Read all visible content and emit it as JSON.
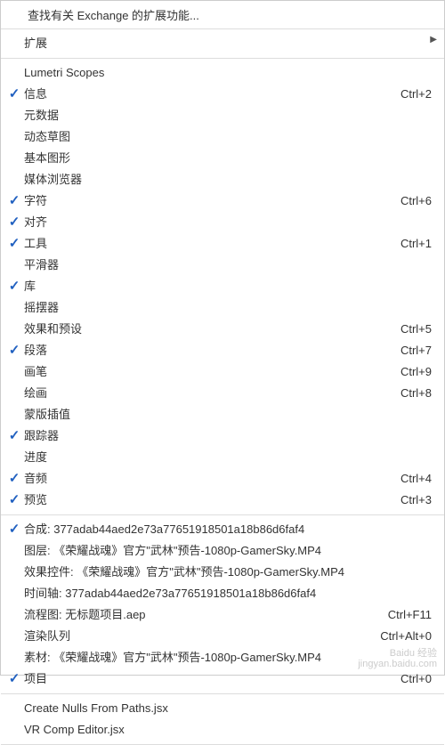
{
  "top": {
    "label": "查找有关 Exchange 的扩展功能..."
  },
  "extensions_header": {
    "label": "扩展"
  },
  "submenu_arrow": "▶",
  "panels": [
    {
      "checked": false,
      "label": "Lumetri Scopes",
      "shortcut": "",
      "name": "lumetri-scopes"
    },
    {
      "checked": true,
      "label": "信息",
      "shortcut": "Ctrl+2",
      "name": "info"
    },
    {
      "checked": false,
      "label": "元数据",
      "shortcut": "",
      "name": "metadata"
    },
    {
      "checked": false,
      "label": "动态草图",
      "shortcut": "",
      "name": "motion-sketch"
    },
    {
      "checked": false,
      "label": "基本图形",
      "shortcut": "",
      "name": "essential-graphics"
    },
    {
      "checked": false,
      "label": "媒体浏览器",
      "shortcut": "",
      "name": "media-browser"
    },
    {
      "checked": true,
      "label": "字符",
      "shortcut": "Ctrl+6",
      "name": "character"
    },
    {
      "checked": true,
      "label": "对齐",
      "shortcut": "",
      "name": "align"
    },
    {
      "checked": true,
      "label": "工具",
      "shortcut": "Ctrl+1",
      "name": "tools"
    },
    {
      "checked": false,
      "label": "平滑器",
      "shortcut": "",
      "name": "smoother"
    },
    {
      "checked": true,
      "label": "库",
      "shortcut": "",
      "name": "libraries"
    },
    {
      "checked": false,
      "label": "摇摆器",
      "shortcut": "",
      "name": "wiggler"
    },
    {
      "checked": false,
      "label": "效果和预设",
      "shortcut": "Ctrl+5",
      "name": "effects-presets"
    },
    {
      "checked": true,
      "label": "段落",
      "shortcut": "Ctrl+7",
      "name": "paragraph"
    },
    {
      "checked": false,
      "label": "画笔",
      "shortcut": "Ctrl+9",
      "name": "brushes"
    },
    {
      "checked": false,
      "label": "绘画",
      "shortcut": "Ctrl+8",
      "name": "paint"
    },
    {
      "checked": false,
      "label": "蒙版插值",
      "shortcut": "",
      "name": "mask-interpolation"
    },
    {
      "checked": true,
      "label": "跟踪器",
      "shortcut": "",
      "name": "tracker"
    },
    {
      "checked": false,
      "label": "进度",
      "shortcut": "",
      "name": "progress"
    },
    {
      "checked": true,
      "label": "音频",
      "shortcut": "Ctrl+4",
      "name": "audio"
    },
    {
      "checked": true,
      "label": "预览",
      "shortcut": "Ctrl+3",
      "name": "preview"
    }
  ],
  "workspace_items": [
    {
      "checked": true,
      "label": "合成: 377adab44aed2e73a77651918501a18b86d6faf4",
      "shortcut": "",
      "name": "composition"
    },
    {
      "checked": false,
      "label": "图层: 《荣耀战魂》官方\"武林\"预告-1080p-GamerSky.MP4",
      "shortcut": "",
      "name": "layer"
    },
    {
      "checked": false,
      "label": "效果控件: 《荣耀战魂》官方\"武林\"预告-1080p-GamerSky.MP4",
      "shortcut": "",
      "name": "effect-controls"
    },
    {
      "checked": false,
      "label": "时间轴: 377adab44aed2e73a77651918501a18b86d6faf4",
      "shortcut": "",
      "name": "timeline"
    },
    {
      "checked": false,
      "label": "流程图: 无标题项目.aep",
      "shortcut": "Ctrl+F11",
      "name": "flowchart"
    },
    {
      "checked": false,
      "label": "渲染队列",
      "shortcut": "Ctrl+Alt+0",
      "name": "render-queue"
    },
    {
      "checked": false,
      "label": "素材: 《荣耀战魂》官方\"武林\"预告-1080p-GamerSky.MP4",
      "shortcut": "",
      "name": "footage"
    },
    {
      "checked": true,
      "label": "项目",
      "shortcut": "Ctrl+0",
      "name": "project"
    }
  ],
  "scripts": [
    {
      "checked": false,
      "label": "Create Nulls From Paths.jsx",
      "shortcut": "",
      "name": "create-nulls"
    },
    {
      "checked": false,
      "label": "VR Comp Editor.jsx",
      "shortcut": "",
      "name": "vr-comp-editor"
    }
  ],
  "watermark": {
    "line1": "Baidu 经验",
    "line2": "jingyan.baidu.com"
  }
}
